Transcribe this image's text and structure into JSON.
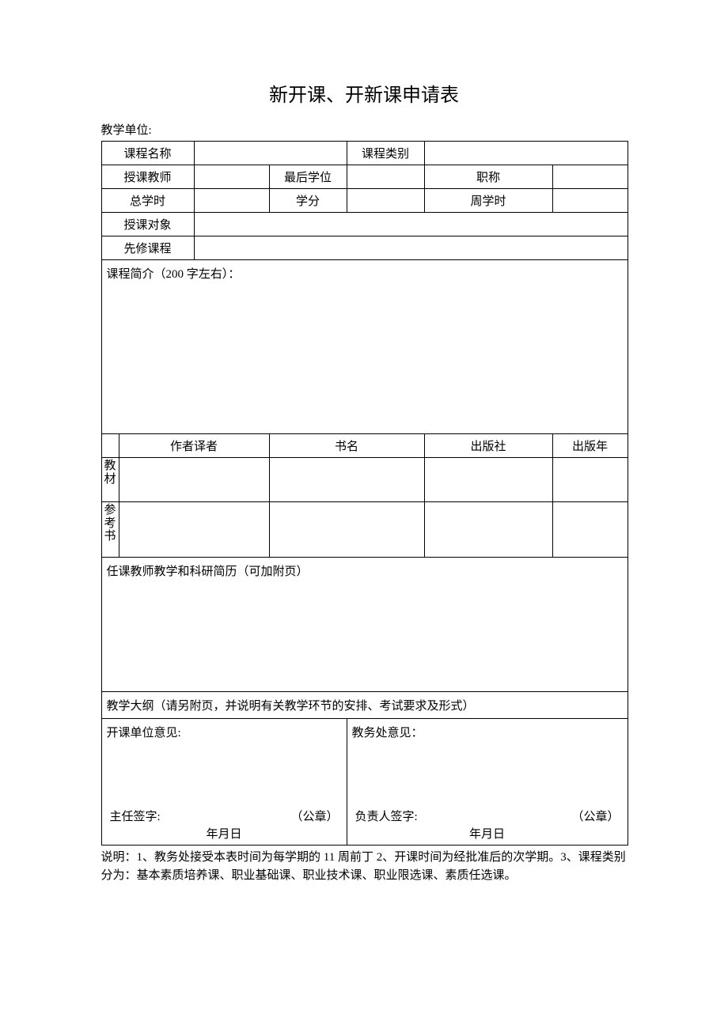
{
  "title": "新开课、开新课申请表",
  "unit_label": "教学单位:",
  "labels": {
    "course_name": "课程名称",
    "course_type": "课程类别",
    "teacher": "授课教师",
    "final_degree": "最后学位",
    "title_rank": "职称",
    "total_hours": "总学时",
    "credits": "学分",
    "weekly_hours": "周学时",
    "target": "授课对象",
    "prerequisites": "先修课程"
  },
  "values": {
    "course_name": "",
    "course_type": "",
    "teacher": "",
    "final_degree": "",
    "title_rank": "",
    "total_hours": "",
    "credits": "",
    "weekly_hours": "",
    "target": "",
    "prerequisites": ""
  },
  "intro_label": "课程简介（200 字左右）：",
  "book_headers": {
    "author": "作者译者",
    "name": "书名",
    "publisher": "出版社",
    "year": "出版年"
  },
  "book_rowheads": {
    "textbook": "教材",
    "reference": "参考书"
  },
  "resume_label": "任课教师教学和科研简历（可加附页）",
  "syllabus_label": "教学大纲（请另附页，并说明有关教学环节的安排、考试要求及形式）",
  "opinion": {
    "dept_label": "开课单位意见:",
    "office_label": "教务处意见：",
    "dept_sign": "主任签字:",
    "office_sign": "负责人签字:",
    "seal": "（公章）",
    "date": "年月日"
  },
  "note": "说明：1、教务处接受本表时间为每学期的 11 周前丁 2、开课时间为经批准后的次学期。3、课程类别分为：基本素质培养课、职业基础课、职业技术课、职业限选课、素质任选课。"
}
